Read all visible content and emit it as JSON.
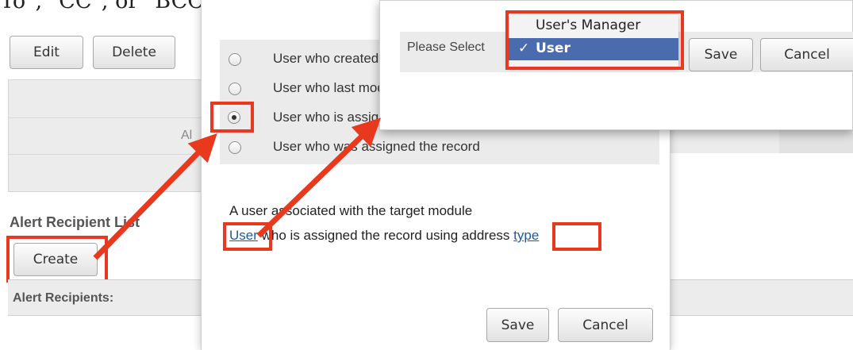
{
  "caption": "To\", \"CC\", or \"BCC\" recipient, and then click \"Save\" to continue.",
  "background": {
    "edit_label": "Edit",
    "delete_label": "Delete",
    "al_text": "Al",
    "recipient_list_title": "Alert Recipient List",
    "create_label": "Create",
    "recipients_header": "Alert Recipients:"
  },
  "dialog": {
    "options": [
      {
        "label": "User who created the record",
        "checked": false
      },
      {
        "label": "User who last modified the record",
        "checked": false
      },
      {
        "label": "User who is assigned the record",
        "checked": true
      },
      {
        "label": "User who was assigned the record",
        "checked": false
      }
    ],
    "description": "A user associated with the target module",
    "user_link": "User",
    "middle_text": " who is assigned the record  using address ",
    "type_link": "type",
    "save_label": "Save",
    "cancel_label": "Cancel"
  },
  "popup": {
    "please_select": "Please Select",
    "dropdown_options": [
      {
        "label": "User's Manager",
        "selected": false
      },
      {
        "label": "User",
        "selected": true
      }
    ],
    "save_label": "Save",
    "cancel_label": "Cancel"
  },
  "colors": {
    "highlight": "#e8391e",
    "selected_option_bg": "#4a6cae",
    "link": "#1a5aa8"
  }
}
